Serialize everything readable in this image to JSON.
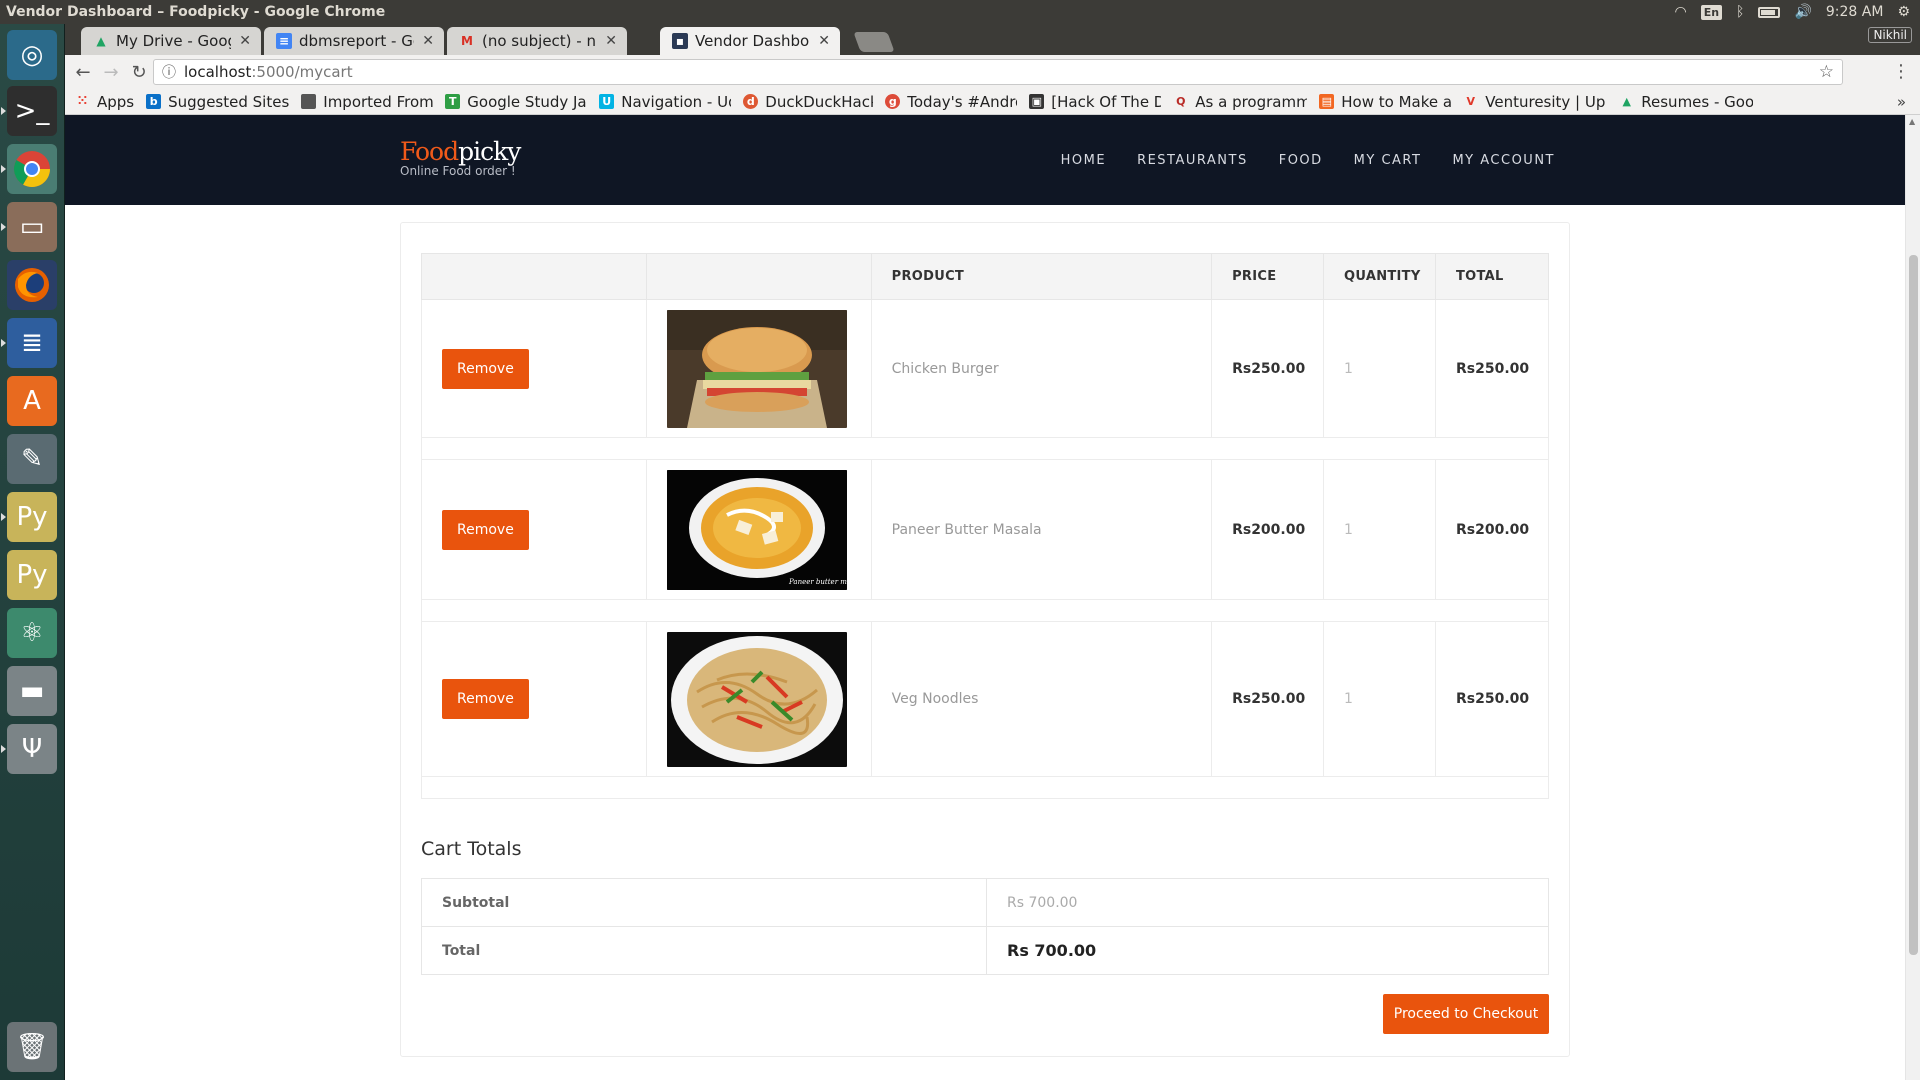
{
  "os": {
    "window_title": "Vendor Dashboard – Foodpicky - Google Chrome",
    "input_lang": "En",
    "clock": "9:28 AM",
    "user": "Nikhil"
  },
  "browser": {
    "tabs": [
      {
        "label": "My Drive - Google D",
        "icon": "google-drive-icon",
        "color": "#1fa463"
      },
      {
        "label": "dbmsreport - Goog",
        "icon": "google-docs-icon",
        "color": "#4285f4"
      },
      {
        "label": "(no subject) - nikhil",
        "icon": "gmail-icon",
        "color": "#d93025"
      },
      {
        "label": "Vendor Dashboard",
        "icon": "page-icon",
        "color": "#2b3a55"
      }
    ],
    "url_host": "localhost",
    "url_path": ":5000/mycart",
    "bookmarks": [
      {
        "label": "Apps",
        "icon": "apps-grid-icon",
        "color": "#e94235"
      },
      {
        "label": "Suggested Sites",
        "icon": "bing-icon",
        "color": "#0a70c8"
      },
      {
        "label": "Imported From I",
        "icon": "folder-icon",
        "color": "#555555"
      },
      {
        "label": "Google Study Ja",
        "icon": "doc-icon",
        "color": "#2e9e44"
      },
      {
        "label": "Navigation - Uda",
        "icon": "udacity-icon",
        "color": "#02b3e4"
      },
      {
        "label": "DuckDuckHack",
        "icon": "duckduckgo-icon",
        "color": "#de5833"
      },
      {
        "label": "Today's #Androi",
        "icon": "google-plus-icon",
        "color": "#dd4b39"
      },
      {
        "label": "[Hack Of The Da",
        "icon": "tv-icon",
        "color": "#333333"
      },
      {
        "label": "As a programme",
        "icon": "quora-icon",
        "color": "#b92b27"
      },
      {
        "label": "How to Make an",
        "icon": "circuit-icon",
        "color": "#f26722"
      },
      {
        "label": "Venturesity | Up",
        "icon": "venturesity-icon",
        "color": "#e0382a"
      },
      {
        "label": "Resumes - Goog",
        "icon": "google-drive-icon",
        "color": "#1fa463"
      }
    ]
  },
  "site": {
    "logo_food": "Food",
    "logo_picky": "picky",
    "tagline": "Online Food order !",
    "nav": [
      "HOME",
      "RESTAURANTS",
      "FOOD",
      "MY CART",
      "MY ACCOUNT"
    ],
    "brand_color": "#e9540d"
  },
  "cart": {
    "headers": [
      "",
      "",
      "PRODUCT",
      "PRICE",
      "QUANTITY",
      "TOTAL"
    ],
    "remove_label": "Remove",
    "items": [
      {
        "name": "Chicken Burger",
        "price": "Rs250.00",
        "qty": "1",
        "total": "Rs250.00"
      },
      {
        "name": "Paneer Butter Masala",
        "price": "Rs200.00",
        "qty": "1",
        "total": "Rs200.00",
        "image_caption": "Paneer butter masala"
      },
      {
        "name": "Veg Noodles",
        "price": "Rs250.00",
        "qty": "1",
        "total": "Rs250.00"
      }
    ]
  },
  "totals": {
    "title": "Cart Totals",
    "subtotal_label": "Subtotal",
    "subtotal_value": "Rs 700.00",
    "total_label": "Total",
    "total_value": "Rs 700.00",
    "checkout_label": "Proceed to Checkout"
  }
}
